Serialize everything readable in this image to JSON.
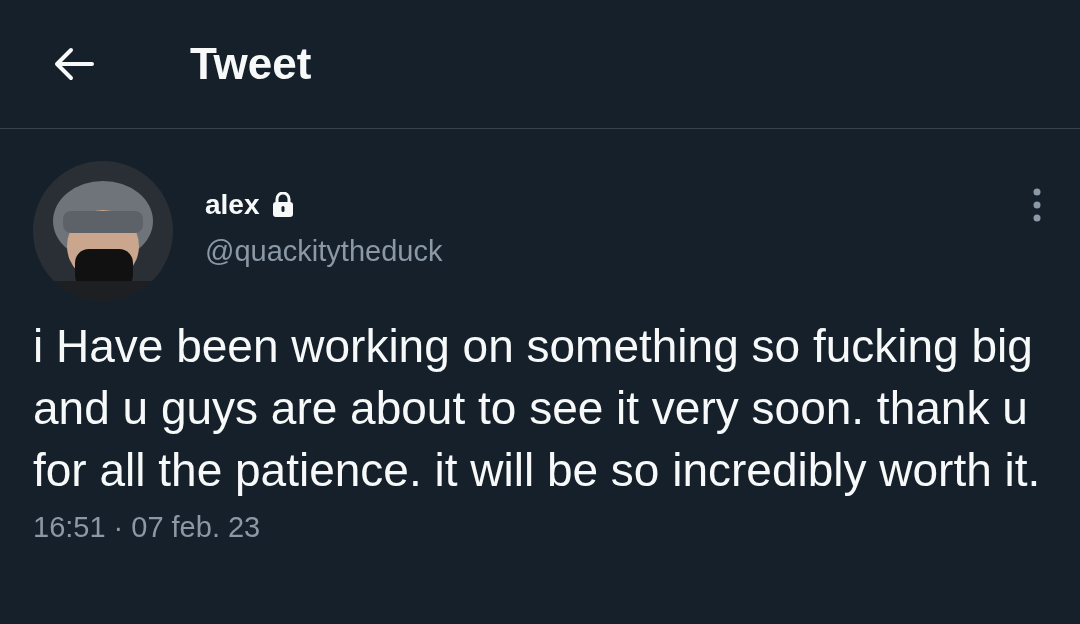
{
  "header": {
    "title": "Tweet"
  },
  "tweet": {
    "author": {
      "name": "alex",
      "handle": "@quackitytheduck",
      "protected": true
    },
    "text": "i Have been working on something so fucking big and u guys are about to see it very soon. thank u for all the patience. it will be so incredibly worth it.",
    "time": "16:51",
    "separator": "·",
    "date": "07 feb. 23"
  }
}
